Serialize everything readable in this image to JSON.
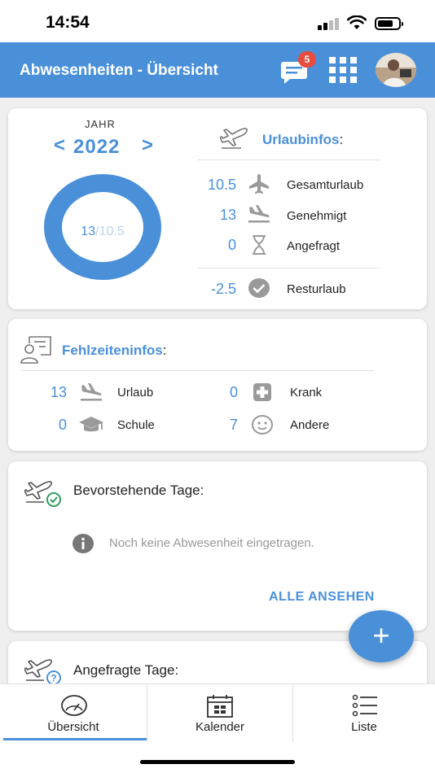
{
  "status_bar": {
    "time": "14:54"
  },
  "header": {
    "title": "Abwesenheiten - Übersicht",
    "notification_count": "5"
  },
  "year_panel": {
    "label": "JAHR",
    "prev": "<",
    "year": "2022",
    "next": ">",
    "donut_taken": "13",
    "donut_separator": "/",
    "donut_total": "10.5"
  },
  "vacation_info": {
    "title": "Urlaubinfos",
    "colon": ":",
    "items": [
      {
        "value": "10.5",
        "label": "Gesamturlaub",
        "icon": "plane-icon"
      },
      {
        "value": "13",
        "label": "Genehmigt",
        "icon": "plane-landing-icon"
      },
      {
        "value": "0",
        "label": "Angefragt",
        "icon": "hourglass-icon"
      }
    ],
    "remaining": {
      "value": "-2.5",
      "label": "Resturlaub",
      "icon": "check-circle-icon"
    }
  },
  "absence_info": {
    "title": "Fehlzeiteninfos",
    "colon": ":",
    "items": [
      {
        "value": "13",
        "label": "Urlaub",
        "icon": "plane-landing-icon"
      },
      {
        "value": "0",
        "label": "Krank",
        "icon": "medical-cross-icon"
      },
      {
        "value": "0",
        "label": "Schule",
        "icon": "graduation-cap-icon"
      },
      {
        "value": "7",
        "label": "Andere",
        "icon": "smiley-icon"
      }
    ]
  },
  "upcoming": {
    "title": "Bevorstehende Tage:",
    "empty_message": "Noch keine Abwesenheit eingetragen.",
    "view_all": "ALLE ANSEHEN"
  },
  "requested": {
    "title": "Angefragte Tage:"
  },
  "fab": {
    "label": "+"
  },
  "tabs": [
    {
      "label": "Übersicht",
      "icon": "speedometer-icon",
      "active": true
    },
    {
      "label": "Kalender",
      "icon": "calendar-icon",
      "active": false
    },
    {
      "label": "Liste",
      "icon": "list-icon",
      "active": false
    }
  ],
  "colors": {
    "accent": "#4a90d9",
    "badge": "#e74c3c",
    "icon_grey": "#9a9a9a"
  }
}
